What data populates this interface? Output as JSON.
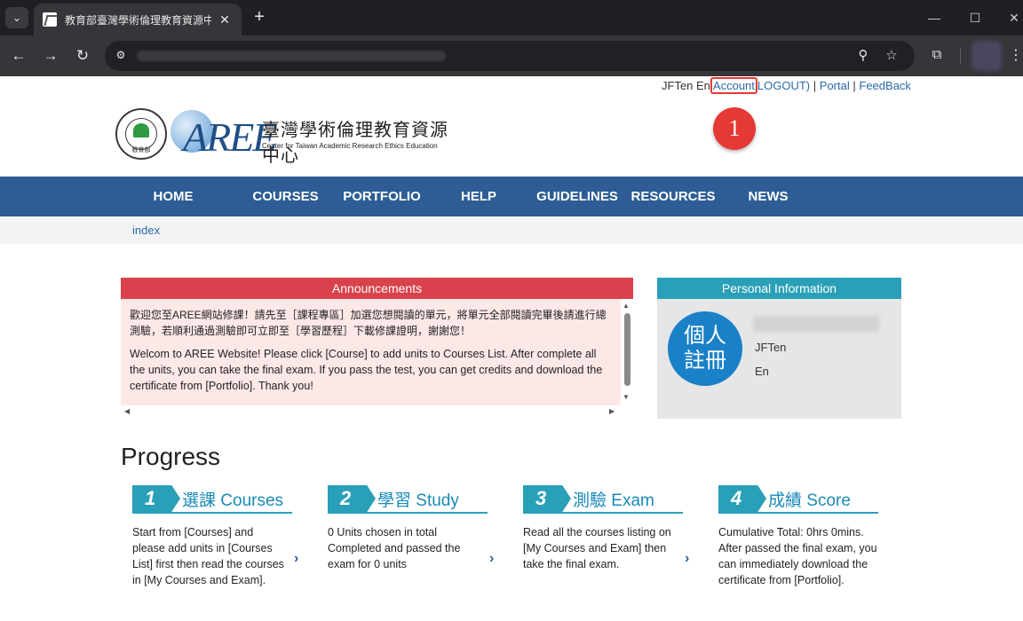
{
  "browser": {
    "tab_title": "教育部臺灣學術倫理教育資源中",
    "menu_icon": "chevron-down-icon",
    "close_glyph": "✕",
    "newtab_glyph": "+"
  },
  "header": {
    "user_name": "JFTen En",
    "account_link": "Account",
    "logout_link": "LOGOUT)",
    "sep1": "|",
    "portal_link": "Portal",
    "sep2": "|",
    "feedback_link": "FeedBack",
    "annotation_badge": "1"
  },
  "logo": {
    "seal_text": "教育部",
    "mark": "AREE",
    "name_cn": "臺灣學術倫理教育資源中心",
    "name_en": "Center for Taiwan Academic Research Ethics Education"
  },
  "nav": {
    "items": [
      "HOME",
      "COURSES",
      "PORTFOLIO",
      "HELP",
      "GUIDELINES",
      "RESOURCES",
      "NEWS"
    ]
  },
  "breadcrumb": {
    "label": "index"
  },
  "announcements": {
    "title": "Announcements",
    "text_zh": "歡迎您至AREE網站修課！請先至［課程專區］加選您想閱讀的單元，將單元全部閱讀完畢後請進行總測驗，若順利通過測驗即可立即至［學習歷程］下載修課證明，謝謝您！",
    "text_en": "Welcom to AREE Website! Please click [Course] to add units to Courses List. After complete all the units, you can take the final exam.  If you pass the test, you can get credits and download the certificate from [Portfolio]. Thank you!"
  },
  "personal_info": {
    "title": "Personal Information",
    "avatar_line1": "個人",
    "avatar_line2": "註冊",
    "first_name": "JFTen",
    "last_name": "En"
  },
  "progress": {
    "title": "Progress",
    "steps": [
      {
        "num": "1",
        "label": "選課 Courses",
        "desc": "Start from [Courses] and please add units in [Courses List] first then read the courses in [My Courses and Exam]."
      },
      {
        "num": "2",
        "label": "學習 Study",
        "desc": "0 Units chosen in total Completed and passed the exam for 0 units"
      },
      {
        "num": "3",
        "label": "測驗 Exam",
        "desc": "Read all the courses listing on [My Courses and Exam] then take the final exam."
      },
      {
        "num": "4",
        "label": "成績 Score",
        "desc": "Cumulative Total: 0hrs 0mins. After passed the final exam, you can immediately download the certificate from [Portfolio]."
      }
    ]
  },
  "colors": {
    "nav_bg": "#2d5d94",
    "announce_header": "#d9424c",
    "info_header": "#2aa0b8",
    "highlight": "#e53935"
  }
}
